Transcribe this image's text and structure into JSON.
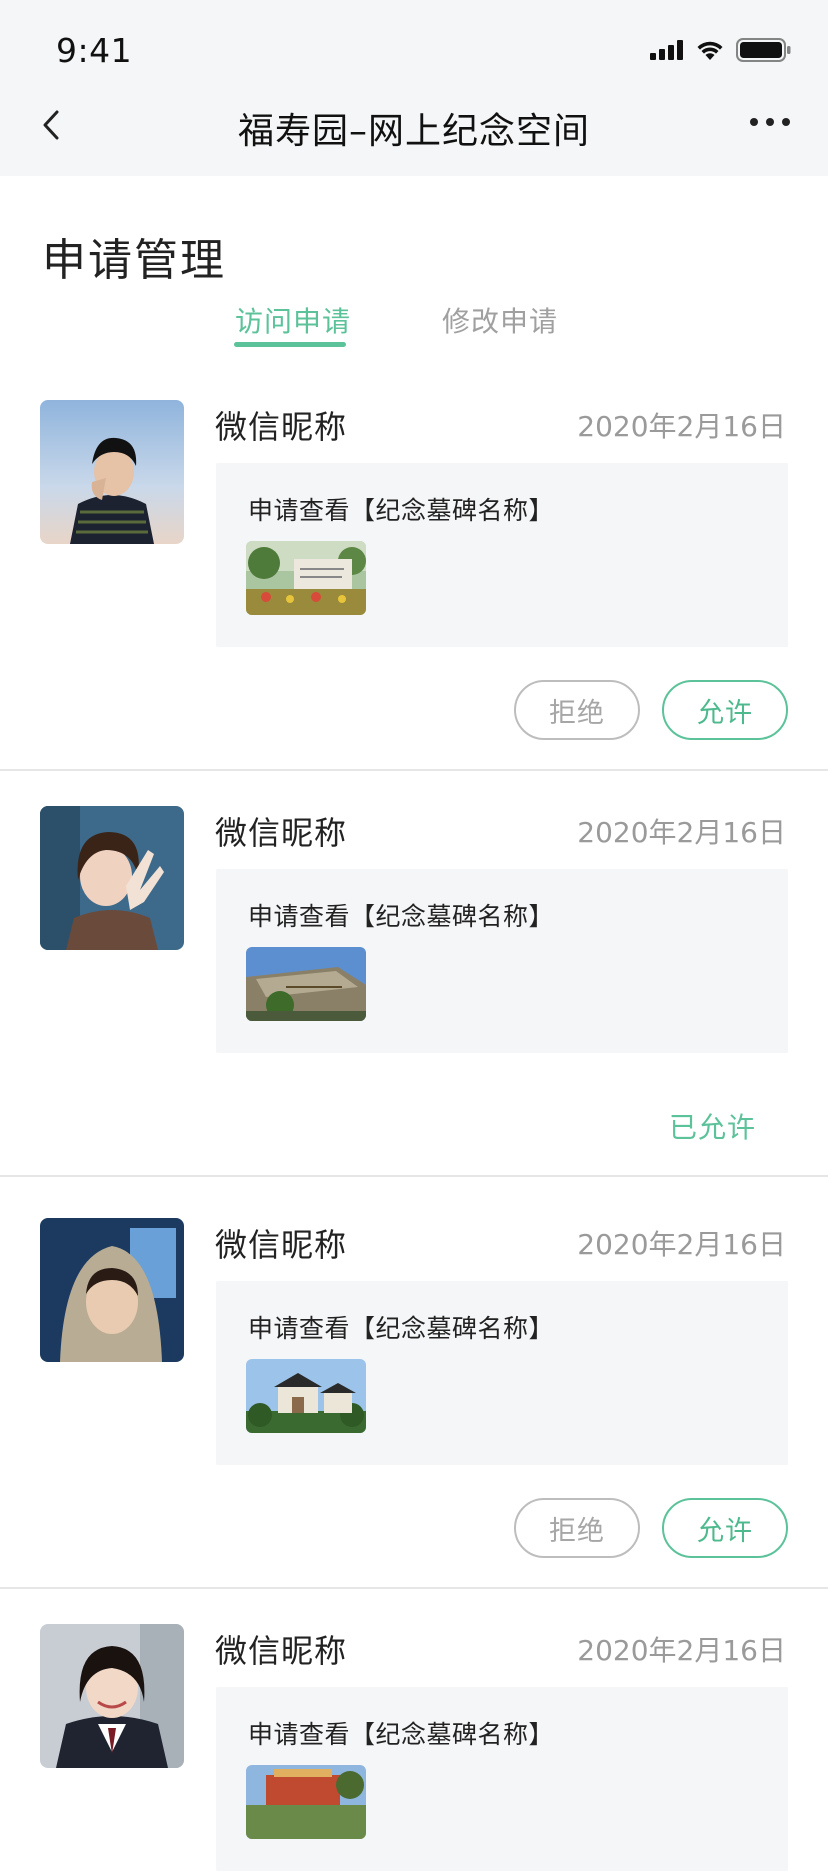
{
  "status_bar": {
    "time": "9:41"
  },
  "nav": {
    "title": "福寿园–网上纪念空间",
    "back_icon": "chevron-left-icon",
    "more_icon": "more-dots-icon"
  },
  "page": {
    "title": "申请管理"
  },
  "tabs": [
    {
      "label": "访问申请",
      "active": true
    },
    {
      "label": "修改申请",
      "active": false
    }
  ],
  "colors": {
    "accent": "#5cc29a",
    "muted": "#9a9a9a",
    "box_bg": "#f5f6f8",
    "topbar_bg": "#f5f6f7"
  },
  "requests": [
    {
      "nickname": "微信昵称",
      "date": "2020年2月16日",
      "text": "申请查看【纪念墓碑名称】",
      "status": "pending",
      "reject_label": "拒绝",
      "allow_label": "允许"
    },
    {
      "nickname": "微信昵称",
      "date": "2020年2月16日",
      "text": "申请查看【纪念墓碑名称】",
      "status": "allowed",
      "status_label": "已允许"
    },
    {
      "nickname": "微信昵称",
      "date": "2020年2月16日",
      "text": "申请查看【纪念墓碑名称】",
      "status": "pending",
      "reject_label": "拒绝",
      "allow_label": "允许"
    },
    {
      "nickname": "微信昵称",
      "date": "2020年2月16日",
      "text": "申请查看【纪念墓碑名称】",
      "status": "pending"
    }
  ]
}
